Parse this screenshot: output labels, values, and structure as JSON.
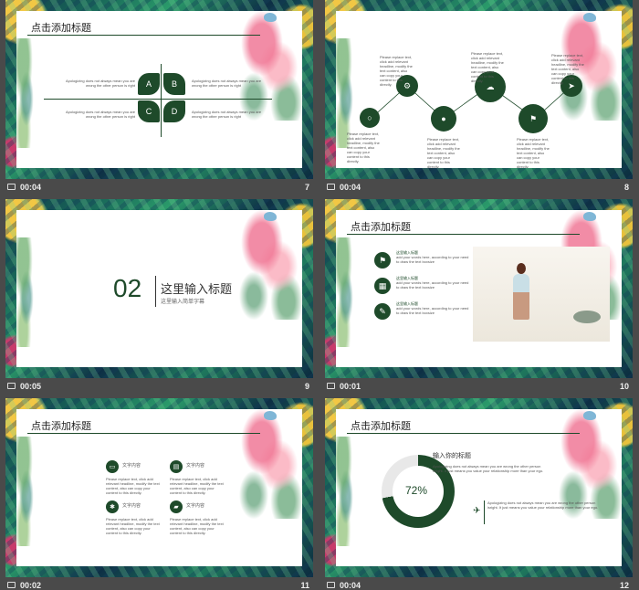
{
  "slides": [
    {
      "time": "00:04",
      "number": "7",
      "title": "点击添加标题",
      "petals": [
        "A",
        "B",
        "C",
        "D"
      ],
      "text_l1": "Apologizing does not always mean you are",
      "text_l2": "wrong the other person is right",
      "text_r1": "Apologizing does not always mean you are",
      "text_r2": "wrong the other person is right",
      "text_l3": "Apologizing does not always mean you are",
      "text_l4": "wrong the other person is right",
      "text_r3": "Apologizing does not always mean you are",
      "text_r4": "wrong the other person is right"
    },
    {
      "time": "00:04",
      "number": "8",
      "blurb": "Please replace text, click add relevant headline, modify the text content, also can copy your content to this directly."
    },
    {
      "time": "00:05",
      "number": "9",
      "section_no": "02",
      "heading": "这里输入标题",
      "sub": "这里输入简单字幕"
    },
    {
      "time": "00:01",
      "number": "10",
      "title": "点击添加标题",
      "items": [
        {
          "head": "这里输入标题",
          "body": "add your words here, according to your need to draw the text boxsize"
        },
        {
          "head": "这里输入标题",
          "body": "add your words here, according to your need to draw the text boxsize"
        },
        {
          "head": "这里输入标题",
          "body": "add your words here, according to your need to draw the text boxsize"
        }
      ]
    },
    {
      "time": "00:02",
      "number": "11",
      "title": "点击添加标题",
      "cards": [
        {
          "head": "文字内容",
          "body": "Please replace text, click add relevant headline, modify the text content, also can copy your content to this directly."
        },
        {
          "head": "文字内容",
          "body": "Please replace text, click add relevant headline, modify the text content, also can copy your content to this directly."
        },
        {
          "head": "文字内容",
          "body": "Please replace text, click add relevant headline, modify the text content, also can copy your content to this directly."
        },
        {
          "head": "文字内容",
          "body": "Please replace text, click add relevant headline, modify the text content, also can copy your content to this directly."
        }
      ]
    },
    {
      "time": "00:04",
      "number": "12",
      "title": "点击添加标题",
      "percent_label": "72%",
      "percent": 72,
      "heading": "输入你的标题",
      "para1": "Apologizing does not always mean you are wrong the other person isright. It just means you value your relationship more than your ego.",
      "para2": "Apologizing does not always mean you are wrong the other person isright. It just means you value your relationship more than your ego."
    }
  ]
}
